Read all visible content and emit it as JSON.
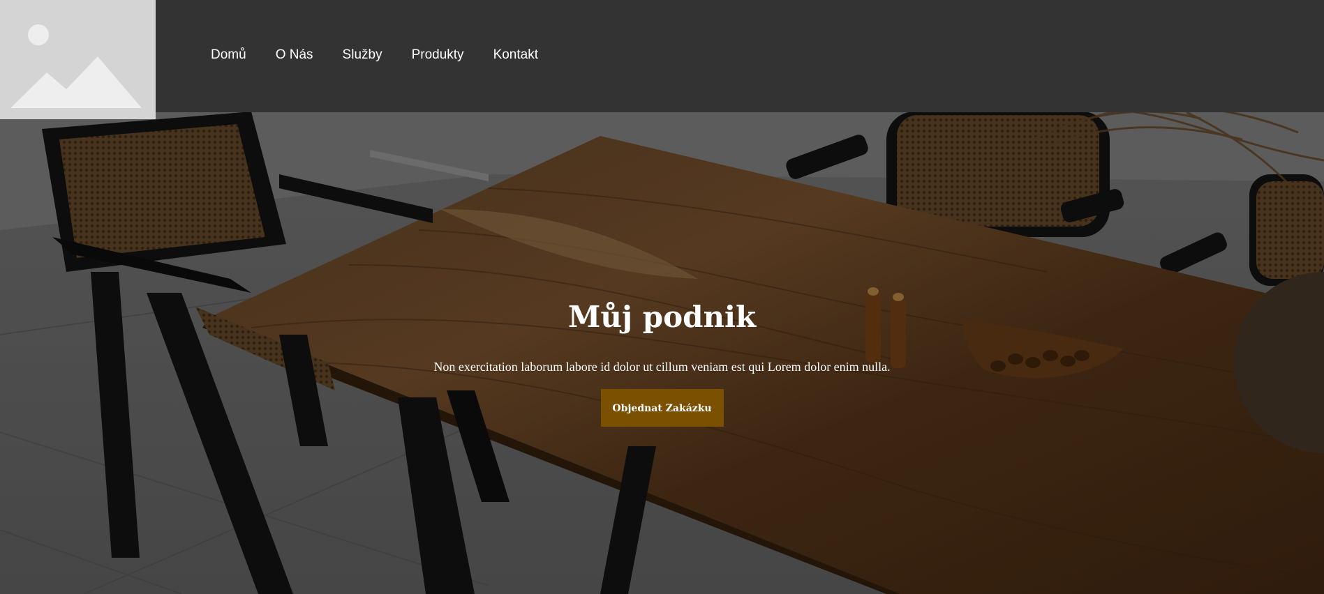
{
  "nav": {
    "items": [
      {
        "label": "Domů"
      },
      {
        "label": "O Nás"
      },
      {
        "label": "Služby"
      },
      {
        "label": "Produkty"
      },
      {
        "label": "Kontakt"
      }
    ]
  },
  "hero": {
    "title": "Můj podnik",
    "subtitle": "Non exercitation laborum labore id dolor ut cillum veniam est qui Lorem dolor enim nulla.",
    "button_label": "Objednat Zakázku",
    "background_image": "dining-table-with-rattan-chairs"
  },
  "logo": {
    "icon": "image-placeholder-icon"
  },
  "colors": {
    "header_bg": "#333333",
    "button_bg": "#7b5000",
    "text": "#ffffff",
    "logo_bg": "#d4d4d4"
  }
}
